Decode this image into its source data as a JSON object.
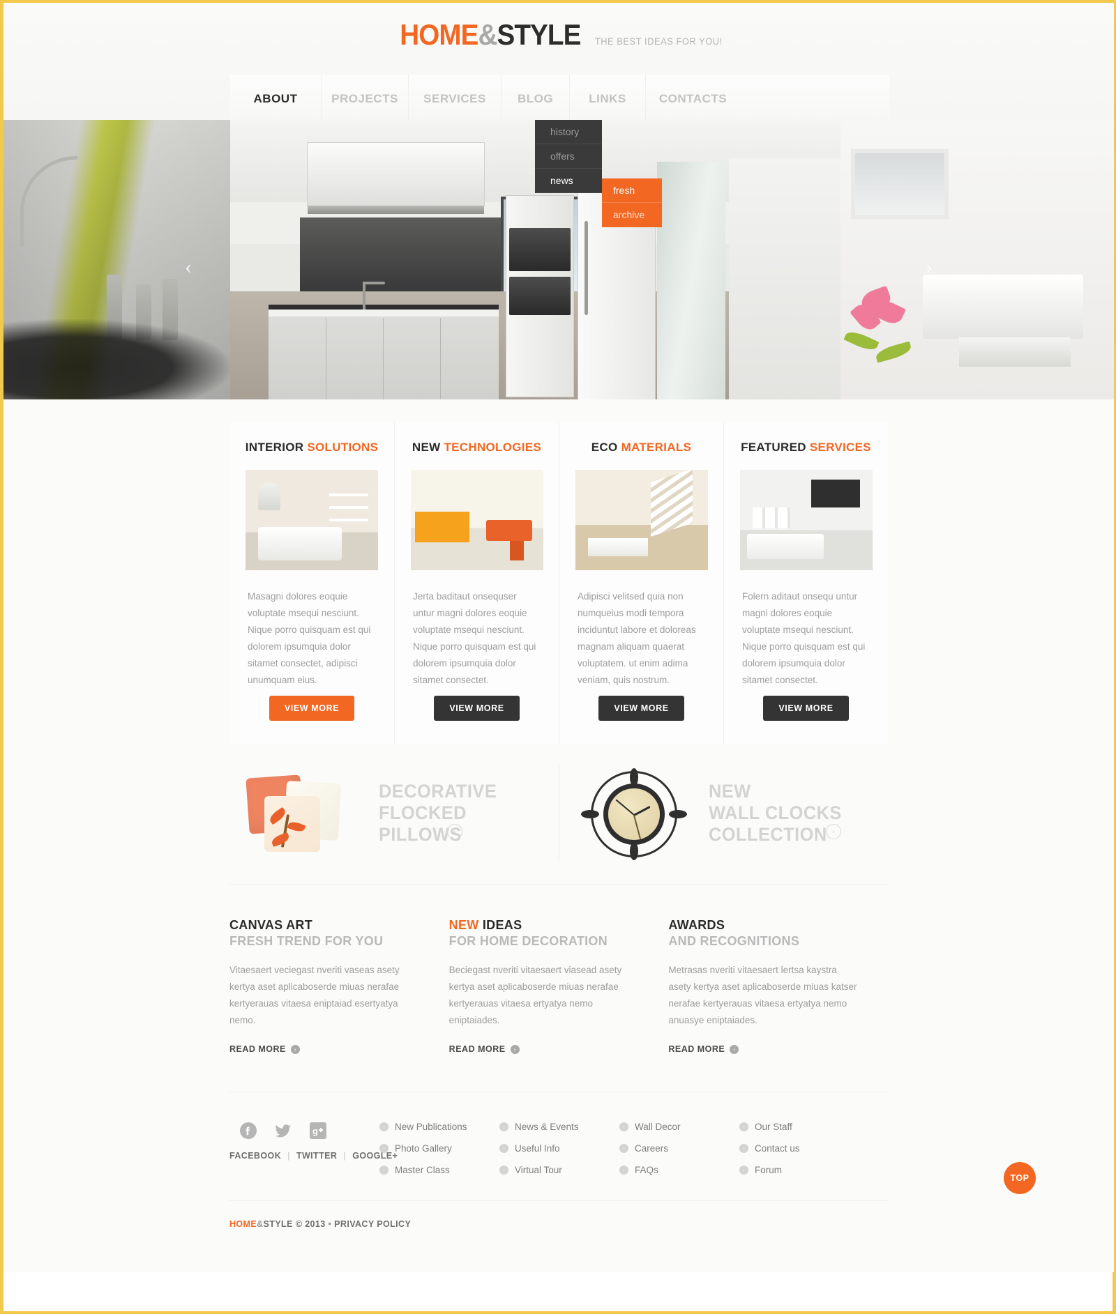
{
  "header": {
    "logo": {
      "part1": "HOME",
      "amp": "&",
      "part2": "STYLE"
    },
    "tagline": "THE BEST IDEAS FOR YOU!"
  },
  "nav": {
    "items": [
      {
        "label": "ABOUT",
        "active": true
      },
      {
        "label": "PROJECTS",
        "active": false
      },
      {
        "label": "SERVICES",
        "active": false
      },
      {
        "label": "BLOG",
        "active": false
      },
      {
        "label": "LINKS",
        "active": false
      },
      {
        "label": "CONTACTS",
        "active": false
      }
    ],
    "dropdown": [
      "history",
      "offers",
      "news"
    ],
    "dropdown_active": "news",
    "submenu": [
      "fresh",
      "archive"
    ],
    "submenu_active": "fresh"
  },
  "slider": {
    "prev": "‹",
    "next": "›"
  },
  "features": [
    {
      "title_dark": "INTERIOR",
      "title_orange": "SOLUTIONS",
      "text": "Masagni dolores eoquie voluptate msequi nesciunt. Nique porro quisquam est qui dolorem ipsumquia dolor sitamet consectet, adipisci unumquam eius.",
      "button": "VIEW MORE",
      "button_style": "orange"
    },
    {
      "title_dark": "NEW",
      "title_orange": "TECHNOLOGIES",
      "text": "Jerta baditaut onsequser untur magni dolores eoquie voluptate msequi nesciunt. Nique porro quisquam est qui dolorem ipsumquia dolor sitamet consectet.",
      "button": "VIEW MORE",
      "button_style": "dark"
    },
    {
      "title_dark": "ECO",
      "title_orange": "MATERIALS",
      "text": "Adipisci velitsed quia non numqueius modi tempora inciduntut labore et doloreas magnam aliquam quaerat voluptatem. ut enim adima veniam, quis nostrum.",
      "button": "VIEW MORE",
      "button_style": "dark"
    },
    {
      "title_dark": "FEATURED",
      "title_orange": "SERVICES",
      "text": "Folern aditaut onsequ untur magni dolores eoquie voluptate msequi nesciunt. Nique porro quisquam est qui dolorem ipsumquia dolor sitamet consectet.",
      "button": "VIEW MORE",
      "button_style": "dark"
    }
  ],
  "banners": [
    {
      "line1": "DECORATIVE",
      "line2": "FLOCKED",
      "line3": "PILLOWS",
      "arrow": "›"
    },
    {
      "line1": "NEW",
      "line2": "WALL CLOCKS",
      "line3": "COLLECTION",
      "arrow": "›"
    }
  ],
  "info_blocks": [
    {
      "title_dark": "CANVAS ART",
      "title_orange": "",
      "subtitle": "FRESH TREND FOR YOU",
      "text": "Vitaesaert veciegast nveriti vaseas asety kertya aset aplicaboserde miuas nerafae kertyerauas vitaesa eniptaiad esertyatya nemo.",
      "readmore": "READ MORE",
      "arrow": "›"
    },
    {
      "title_dark": " IDEAS",
      "title_orange": "NEW",
      "subtitle": "FOR HOME DECORATION",
      "text": "Beciegast nveriti vitaesaert viasead asety kertya aset aplicaboserde miuas nerafae kertyerauas vitaesa ertyatya nemo eniptaiades.",
      "readmore": "READ MORE",
      "arrow": "›"
    },
    {
      "title_dark": "AWARDS",
      "title_orange": "",
      "subtitle": "AND RECOGNITIONS",
      "text": "Metrasas nveriti vitaesaert lertsa kaystra asety kertya aset aplicaboserde miuas katser nerafae kertyerauas vitaesa ertyatya nemo anuasye eniptaiades.",
      "readmore": "READ MORE",
      "arrow": "›"
    }
  ],
  "footer": {
    "social": [
      {
        "name": "FACEBOOK",
        "icon": "facebook-icon"
      },
      {
        "name": "TWITTER",
        "icon": "twitter-icon"
      },
      {
        "name": "GOOGLE+",
        "icon": "googleplus-icon"
      }
    ],
    "separator": "|",
    "link_columns": [
      [
        "New Publications",
        "Photo Gallery",
        "Master Class"
      ],
      [
        "News & Events",
        "Useful Info",
        "Virtual Tour"
      ],
      [
        "Wall Decor",
        "Careers",
        "FAQs"
      ],
      [
        "Our Staff",
        "Contact us",
        "Forum"
      ]
    ],
    "link_bullet": "›",
    "copyright_brand1": "HOME",
    "copyright_amp": "&",
    "copyright_brand2": "STYLE",
    "copyright_year": "© 2013",
    "copyright_dot": "•",
    "privacy": "PRIVACY POLICY",
    "to_top": "TOP"
  },
  "colors": {
    "accent": "#f26722",
    "dark": "#2b2b2b",
    "muted": "#9d9d9d",
    "frame": "#f2c94c"
  }
}
